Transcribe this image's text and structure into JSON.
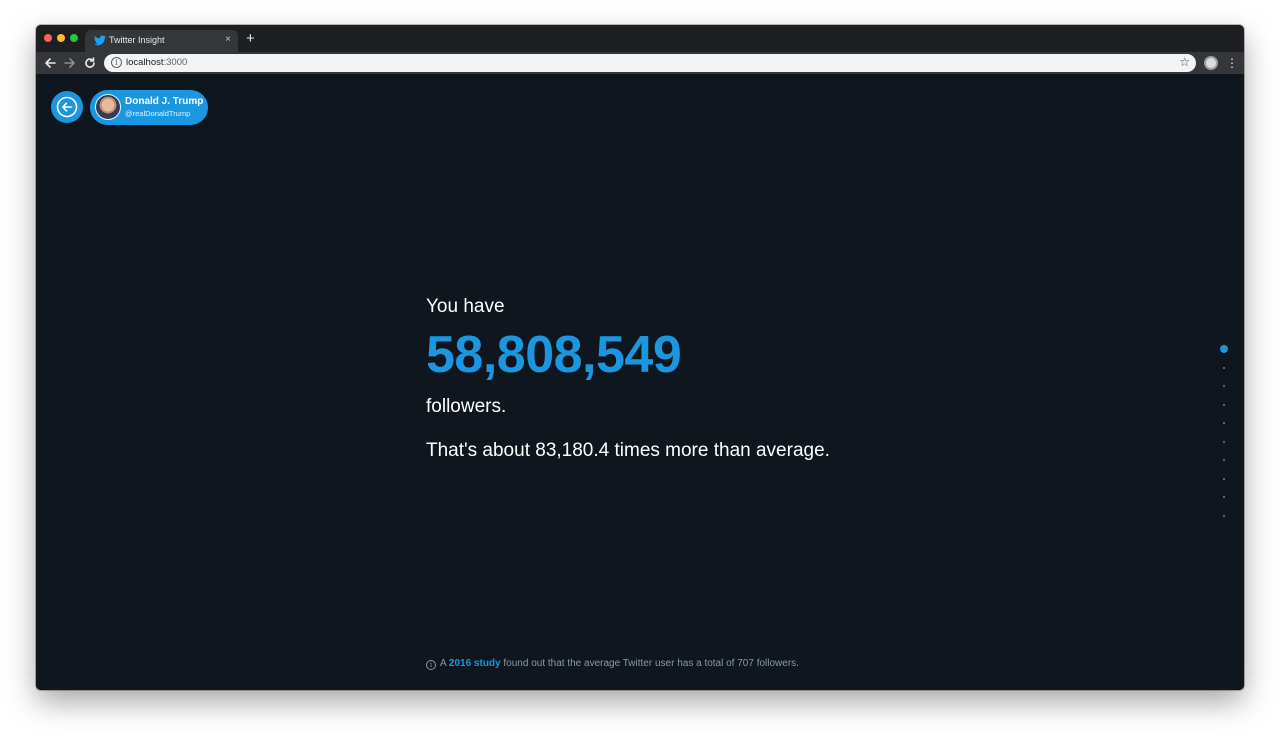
{
  "browser": {
    "tab_title": "Twitter Insight",
    "tab_close": "×",
    "new_tab": "+",
    "url_host": "localhost",
    "url_port": ":3000",
    "icons": [
      "back-arrow-icon",
      "forward-arrow-icon",
      "reload-icon",
      "info-icon",
      "star-icon",
      "profile-icon",
      "menu-icon",
      "twitter-bird-icon"
    ]
  },
  "user": {
    "name": "Donald J. Trump",
    "handle": "@realDonaldTrump"
  },
  "main": {
    "lead": "You have",
    "count": "58,808,549",
    "unit": "followers.",
    "comparison": "That's about 83,180.4 times more than average."
  },
  "footnote": {
    "prefix": "A ",
    "link": "2016 study",
    "suffix": " found out that the average Twitter user has a total of 707 followers."
  },
  "pagination": {
    "total": 10,
    "active": 1
  },
  "colors": {
    "accent": "#1a97e0",
    "background": "#0f161e",
    "text": "#ffffff",
    "muted": "#8899a6"
  }
}
